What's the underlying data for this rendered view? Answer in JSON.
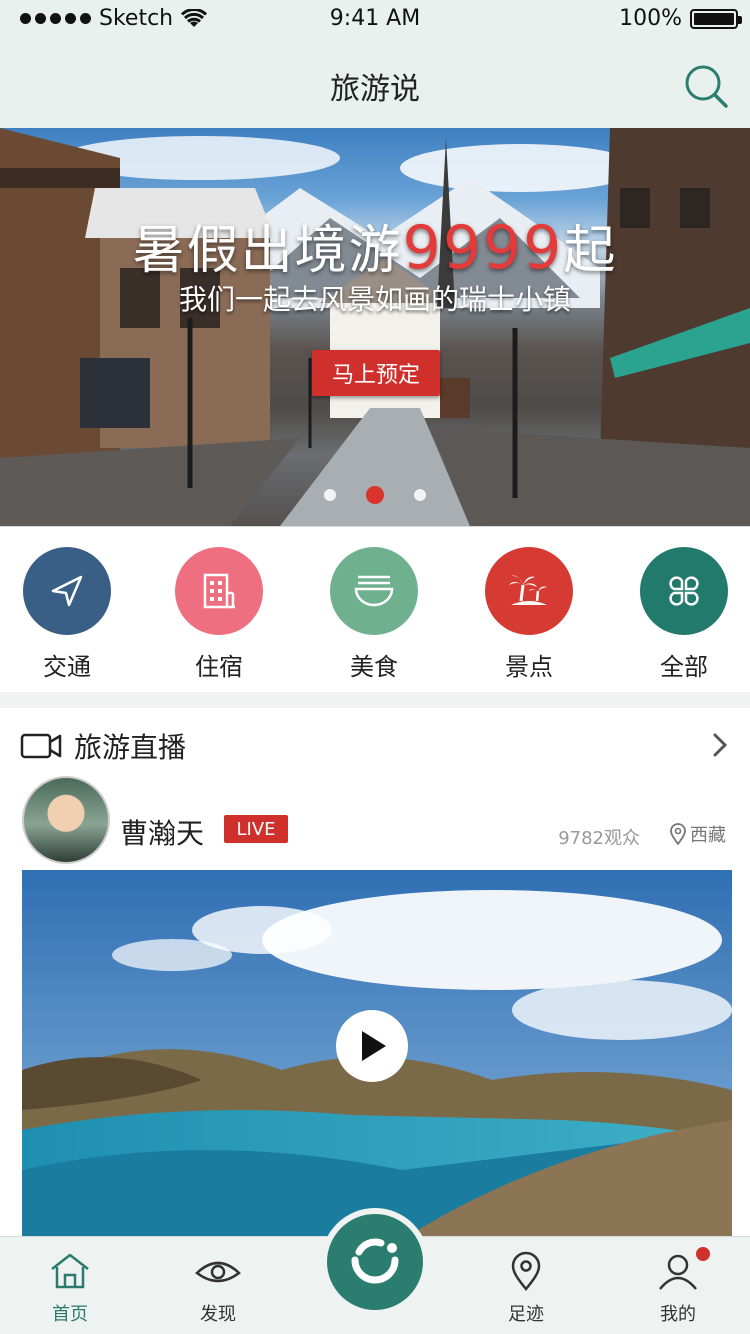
{
  "status": {
    "carrier": "Sketch",
    "time": "9:41 AM",
    "battery": "100%"
  },
  "nav": {
    "title": "旅游说"
  },
  "banner": {
    "title_prefix": "暑假出境游",
    "title_number": "9999",
    "title_suffix": "起",
    "subtitle": "我们一起去风景如画的瑞士小镇",
    "button": "马上预定",
    "pages": 3,
    "active_page": 2
  },
  "categories": [
    {
      "label": "交通",
      "icon": "navigation-arrow-icon",
      "color": "#3a5f86"
    },
    {
      "label": "住宿",
      "icon": "hotel-building-icon",
      "color": "#ee6f7f"
    },
    {
      "label": "美食",
      "icon": "noodle-bowl-icon",
      "color": "#6fb08f"
    },
    {
      "label": "景点",
      "icon": "palm-island-icon",
      "color": "#d63b33"
    },
    {
      "label": "全部",
      "icon": "clover-grid-icon",
      "color": "#227a6c"
    }
  ],
  "live": {
    "title": "旅游直播",
    "author": "曹瀚天",
    "badge": "LIVE",
    "viewers": "9782观众",
    "location": "西藏"
  },
  "tabbar": {
    "items": [
      {
        "label": "首页",
        "icon": "home-icon",
        "active": true
      },
      {
        "label": "发现",
        "icon": "eye-icon",
        "active": false
      },
      {
        "label": "",
        "icon": "camera-center-icon",
        "active": false
      },
      {
        "label": "足迹",
        "icon": "location-pin-icon",
        "active": false
      },
      {
        "label": "我的",
        "icon": "user-icon",
        "active": false
      }
    ]
  },
  "colors": {
    "accent": "#2a7d6f",
    "brand_red": "#d0302c"
  }
}
